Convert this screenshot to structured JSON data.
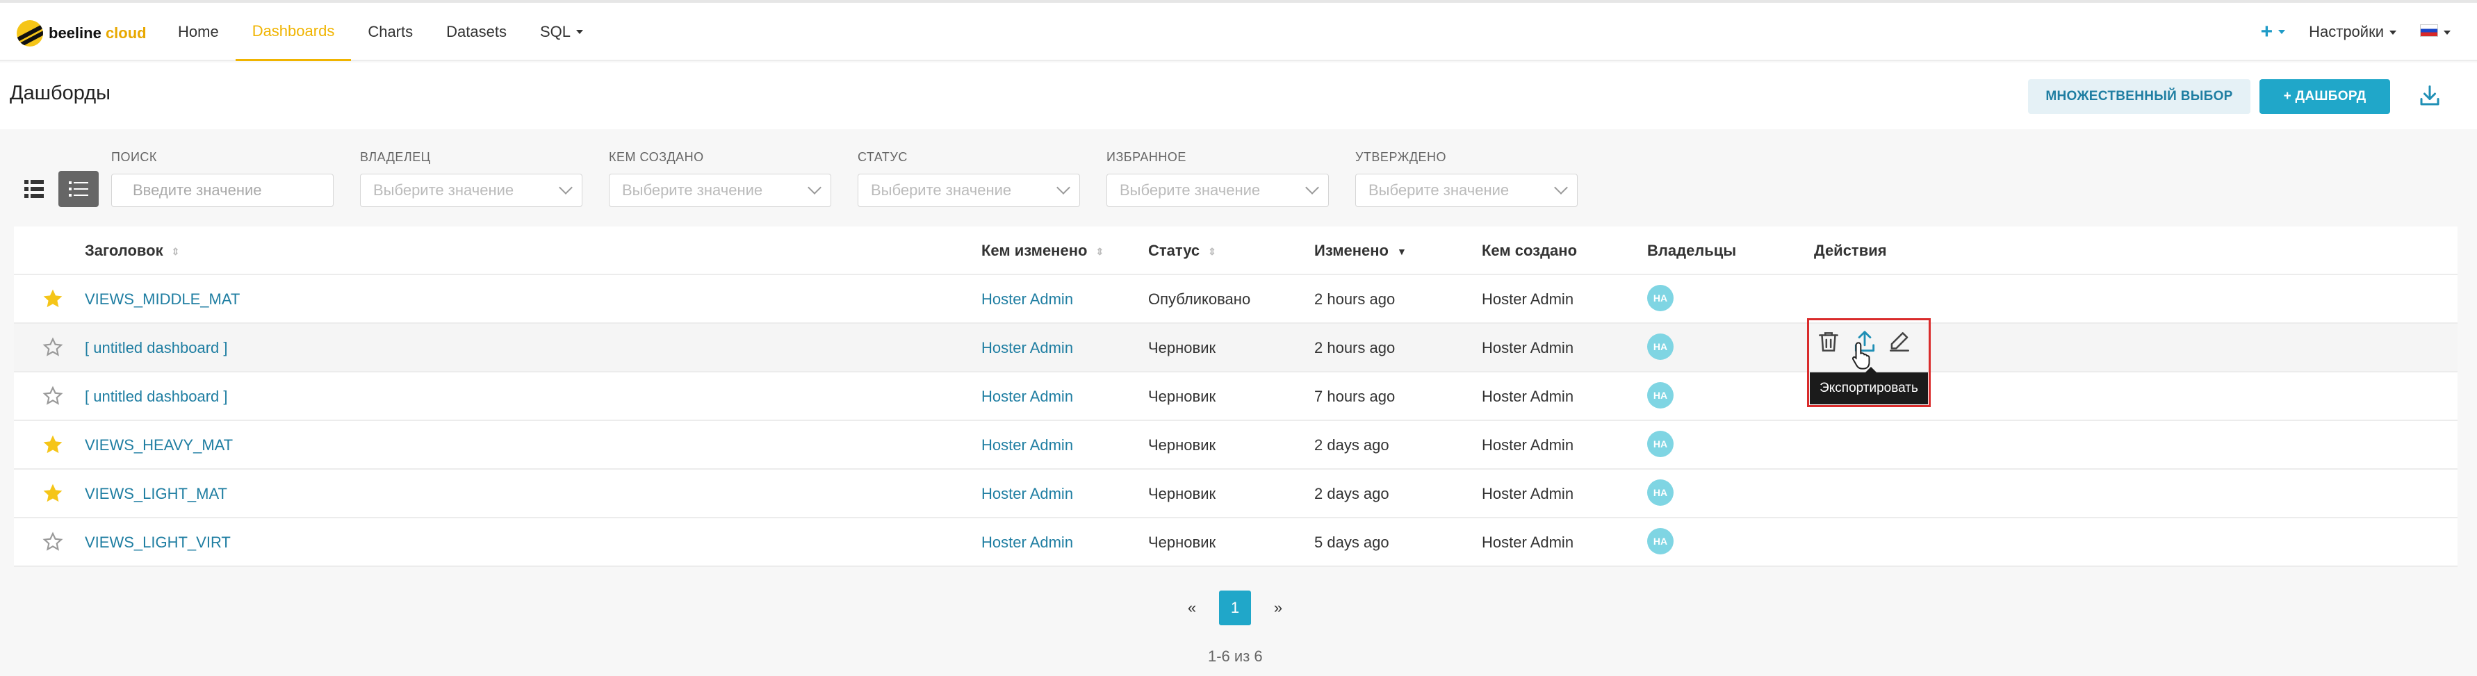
{
  "brand": {
    "name": "beeline",
    "accent": "cloud"
  },
  "nav": {
    "items": [
      {
        "label": "Home",
        "active": false
      },
      {
        "label": "Dashboards",
        "active": true
      },
      {
        "label": "Charts",
        "active": false
      },
      {
        "label": "Datasets",
        "active": false
      },
      {
        "label": "SQL",
        "active": false
      }
    ],
    "settings_label": "Настройки",
    "plus_label": "+"
  },
  "header": {
    "title": "Дашборды",
    "multi_select_label": "МНОЖЕСТВЕННЫЙ ВЫБОР",
    "add_dashboard_label": "+ ДАШБОРД"
  },
  "filters": {
    "search": {
      "label": "ПОИСК",
      "placeholder": "Введите значение"
    },
    "owner": {
      "label": "ВЛАДЕЛЕЦ",
      "placeholder": "Выберите значение"
    },
    "created_by": {
      "label": "КЕМ СОЗДАНО",
      "placeholder": "Выберите значение"
    },
    "status": {
      "label": "СТАТУС",
      "placeholder": "Выберите значение"
    },
    "favorite": {
      "label": "ИЗБРАННОЕ",
      "placeholder": "Выберите значение"
    },
    "approved": {
      "label": "УТВЕРЖДЕНО",
      "placeholder": "Выберите значение"
    }
  },
  "table": {
    "columns": {
      "title": "Заголовок",
      "modified_by": "Кем изменено",
      "status": "Статус",
      "modified": "Изменено",
      "created_by": "Кем создано",
      "owners": "Владельцы",
      "actions": "Действия"
    },
    "rows": [
      {
        "favorite": true,
        "title": "VIEWS_MIDDLE_MAT",
        "modified_by": "Hoster Admin",
        "status": "Опубликовано",
        "modified": "2 hours ago",
        "created_by": "Hoster Admin",
        "owner_initials": "HA"
      },
      {
        "favorite": false,
        "title": "[ untitled dashboard ]",
        "modified_by": "Hoster Admin",
        "status": "Черновик",
        "modified": "2 hours ago",
        "created_by": "Hoster Admin",
        "owner_initials": "HA"
      },
      {
        "favorite": false,
        "title": "[ untitled dashboard ]",
        "modified_by": "Hoster Admin",
        "status": "Черновик",
        "modified": "7 hours ago",
        "created_by": "Hoster Admin",
        "owner_initials": "HA"
      },
      {
        "favorite": true,
        "title": "VIEWS_HEAVY_MAT",
        "modified_by": "Hoster Admin",
        "status": "Черновик",
        "modified": "2 days ago",
        "created_by": "Hoster Admin",
        "owner_initials": "HA"
      },
      {
        "favorite": true,
        "title": "VIEWS_LIGHT_MAT",
        "modified_by": "Hoster Admin",
        "status": "Черновик",
        "modified": "2 days ago",
        "created_by": "Hoster Admin",
        "owner_initials": "HA"
      },
      {
        "favorite": false,
        "title": "VIEWS_LIGHT_VIRT",
        "modified_by": "Hoster Admin",
        "status": "Черновик",
        "modified": "5 days ago",
        "created_by": "Hoster Admin",
        "owner_initials": "HA"
      }
    ],
    "tooltip": "Экспортировать"
  },
  "pagination": {
    "prev": "«",
    "current": "1",
    "next": "»",
    "count": "1-6 из 6"
  },
  "colors": {
    "accent": "#20a7c9",
    "brand_yellow": "#f0b400",
    "link": "#1f7ea2",
    "highlight": "#d92b2b"
  }
}
